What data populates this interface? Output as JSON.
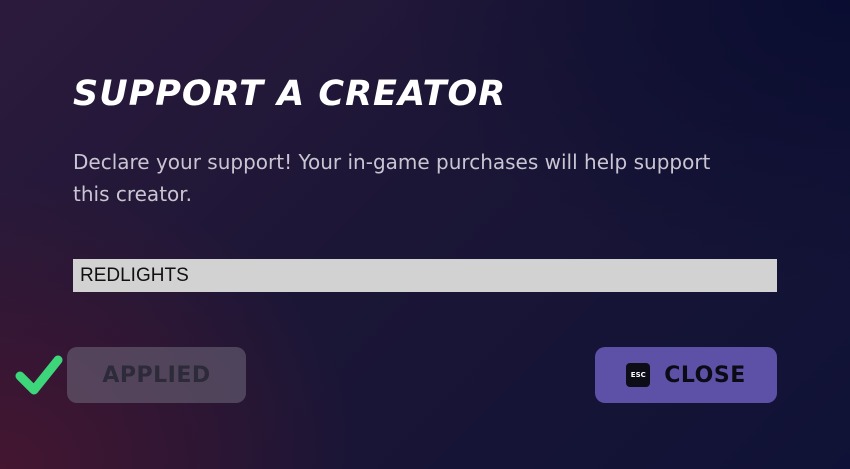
{
  "dialog": {
    "title": "SUPPORT A CREATOR",
    "description": "Declare your support! Your in-game purchases will help support this creator.",
    "creator_field": {
      "value": "REDLIGHTS"
    },
    "applied_button": {
      "label": "APPLIED",
      "status_icon": "check-icon"
    },
    "close_button": {
      "key_hint": "ESC",
      "label": "CLOSE"
    }
  },
  "colors": {
    "check": "#3dd67a",
    "close_button": "#5c51a6",
    "field_background": "#d2d2d2"
  }
}
